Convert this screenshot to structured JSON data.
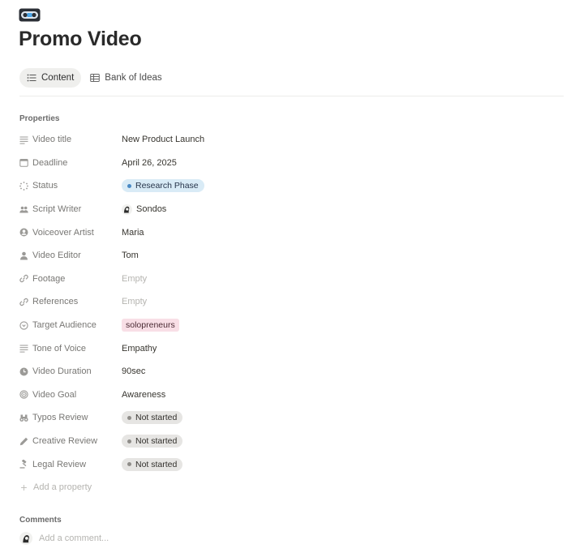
{
  "page": {
    "icon": "videocassette-icon",
    "title": "Promo Video"
  },
  "tabs": [
    {
      "label": "Content",
      "icon": "list-icon",
      "active": true
    },
    {
      "label": "Bank of Ideas",
      "icon": "table-icon",
      "active": false
    }
  ],
  "properties_label": "Properties",
  "properties": [
    {
      "name": "Video title",
      "icon": "text-lines-icon",
      "value": "New Product Launch",
      "kind": "text"
    },
    {
      "name": "Deadline",
      "icon": "calendar-icon",
      "value": "April 26, 2025",
      "kind": "text"
    },
    {
      "name": "Status",
      "icon": "status-icon",
      "value": "Research Phase",
      "kind": "status",
      "color": "#d9ebf6"
    },
    {
      "name": "Script Writer",
      "icon": "people-icon",
      "value": "Sondos",
      "kind": "person"
    },
    {
      "name": "Voiceover Artist",
      "icon": "user-circle-icon",
      "value": "Maria",
      "kind": "text"
    },
    {
      "name": "Video Editor",
      "icon": "person-icon",
      "value": "Tom",
      "kind": "text"
    },
    {
      "name": "Footage",
      "icon": "link-icon",
      "value": "Empty",
      "kind": "empty"
    },
    {
      "name": "References",
      "icon": "link-icon",
      "value": "Empty",
      "kind": "empty"
    },
    {
      "name": "Target Audience",
      "icon": "select-circle-icon",
      "value": "solopreneurs",
      "kind": "tag",
      "color": "#f8dfe6"
    },
    {
      "name": "Tone of Voice",
      "icon": "text-lines-icon",
      "value": "Empathy",
      "kind": "text"
    },
    {
      "name": "Video Duration",
      "icon": "clock-icon",
      "value": "90sec",
      "kind": "text"
    },
    {
      "name": "Video Goal",
      "icon": "target-icon",
      "value": "Awareness",
      "kind": "text"
    },
    {
      "name": "Typos Review",
      "icon": "binoculars-icon",
      "value": "Not started",
      "kind": "status-gray",
      "color": "#e6e5e3"
    },
    {
      "name": "Creative Review",
      "icon": "pencil-icon",
      "value": "Not started",
      "kind": "status-gray",
      "color": "#e6e5e3"
    },
    {
      "name": "Legal Review",
      "icon": "gavel-icon",
      "value": "Not started",
      "kind": "status-gray",
      "color": "#e6e5e3"
    }
  ],
  "add_property_label": "Add a property",
  "comments_label": "Comments",
  "comment_placeholder": "Add a comment..."
}
